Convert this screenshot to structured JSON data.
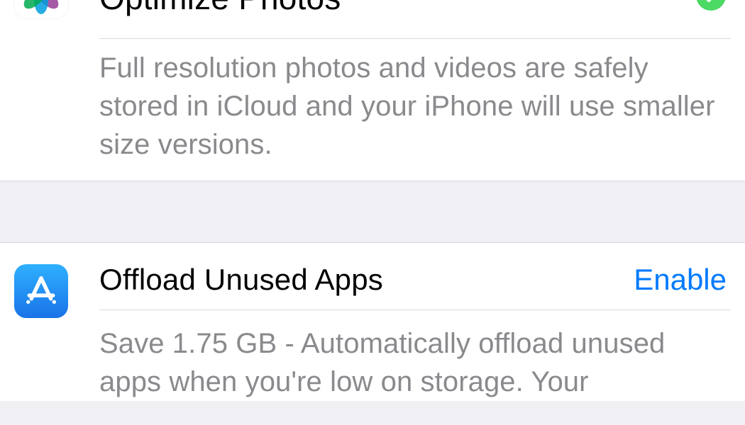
{
  "recommendations": {
    "optimize_photos": {
      "title": "Optimize Photos",
      "description": "Full resolution photos and videos are safely stored in iCloud and your iPhone will use smaller size versions.",
      "status": "enabled"
    },
    "offload_apps": {
      "title": "Offload Unused Apps",
      "action_label": "Enable",
      "description": "Save 1.75 GB - Automatically offload unused apps when you're low on storage. Your"
    }
  }
}
